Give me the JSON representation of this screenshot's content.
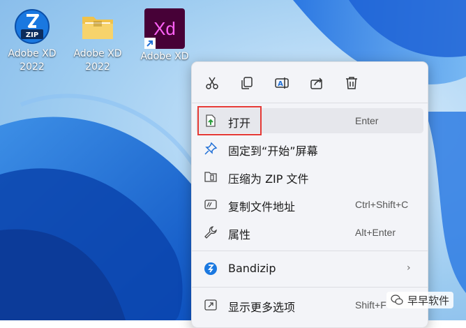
{
  "desktop": {
    "icons": [
      {
        "label_line1": "Adobe XD",
        "label_line2": "2022",
        "icon": "zip-archive-icon"
      },
      {
        "label_line1": "Adobe XD",
        "label_line2": "2022",
        "icon": "folder-icon"
      },
      {
        "label_line1": "Adobe XD",
        "label_line2": "",
        "icon": "adobe-xd-shortcut-icon",
        "app_text": "Xd"
      }
    ]
  },
  "context_menu": {
    "toolbar": [
      "cut-icon",
      "copy-icon",
      "rename-icon",
      "share-icon",
      "delete-icon"
    ],
    "items": [
      {
        "label": "打开",
        "shortcut": "Enter",
        "icon": "open-file-icon"
      },
      {
        "label": "固定到“开始”屏幕",
        "shortcut": "",
        "icon": "pin-icon"
      },
      {
        "label": "压缩为 ZIP 文件",
        "shortcut": "",
        "icon": "zip-folder-icon"
      },
      {
        "label": "复制文件地址",
        "shortcut": "Ctrl+Shift+C",
        "icon": "copy-path-icon"
      },
      {
        "label": "属性",
        "shortcut": "Alt+Enter",
        "icon": "wrench-icon"
      },
      {
        "label": "Bandizip",
        "shortcut": "",
        "icon": "bandizip-icon",
        "submenu": "›"
      },
      {
        "label": "显示更多选项",
        "shortcut": "Shift+F",
        "icon": "more-options-icon"
      }
    ]
  },
  "watermark": {
    "text": "早早软件"
  },
  "colors": {
    "highlight": "#e53935",
    "accent": "#1f6fd6",
    "xd_bg": "#470137",
    "xd_text": "#ff61f6"
  }
}
